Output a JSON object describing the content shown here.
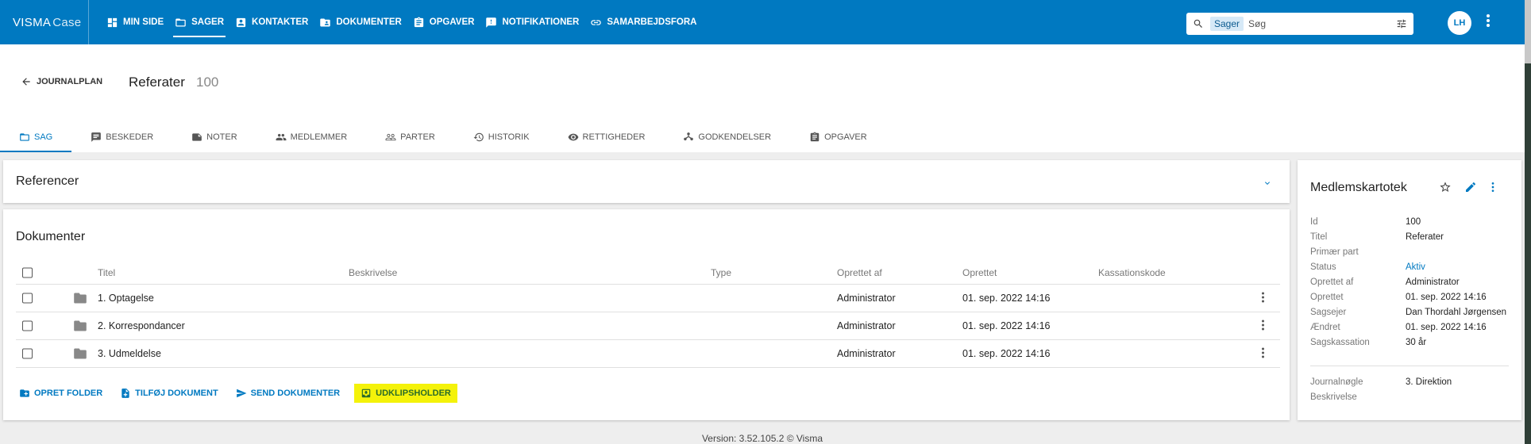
{
  "app": {
    "logo_main": "VISMA",
    "logo_sub": "Case"
  },
  "nav": [
    {
      "label": "MIN SIDE",
      "icon": "dashboard-icon",
      "active": false
    },
    {
      "label": "SAGER",
      "icon": "folder-icon",
      "active": true
    },
    {
      "label": "KONTAKTER",
      "icon": "contact-icon",
      "active": false
    },
    {
      "label": "DOKUMENTER",
      "icon": "folder-shared-icon",
      "active": false
    },
    {
      "label": "OPGAVER",
      "icon": "clipboard-icon",
      "active": false
    },
    {
      "label": "NOTIFIKATIONER",
      "icon": "feedback-icon",
      "active": false
    },
    {
      "label": "SAMARBEJDSFORA",
      "icon": "link-icon",
      "active": false
    }
  ],
  "search": {
    "scope": "Sager",
    "placeholder": "Søg"
  },
  "user": {
    "initials": "LH"
  },
  "header": {
    "back_label": "JOURNALPLAN",
    "title": "Referater",
    "number": "100"
  },
  "tabs": [
    {
      "label": "SAG",
      "active": true
    },
    {
      "label": "BESKEDER",
      "active": false
    },
    {
      "label": "NOTER",
      "active": false
    },
    {
      "label": "MEDLEMMER",
      "active": false
    },
    {
      "label": "PARTER",
      "active": false
    },
    {
      "label": "HISTORIK",
      "active": false
    },
    {
      "label": "RETTIGHEDER",
      "active": false
    },
    {
      "label": "GODKENDELSER",
      "active": false
    },
    {
      "label": "OPGAVER",
      "active": false
    }
  ],
  "references": {
    "title": "Referencer"
  },
  "documents": {
    "title": "Dokumenter",
    "columns": {
      "title": "Titel",
      "description": "Beskrivelse",
      "type": "Type",
      "created_by": "Oprettet af",
      "created": "Oprettet",
      "disposal": "Kassationskode"
    },
    "rows": [
      {
        "title": "1. Optagelse",
        "description": "",
        "type": "",
        "created_by": "Administrator",
        "created": "01. sep. 2022 14:16",
        "disposal": ""
      },
      {
        "title": "2. Korrespondancer",
        "description": "",
        "type": "",
        "created_by": "Administrator",
        "created": "01. sep. 2022 14:16",
        "disposal": ""
      },
      {
        "title": "3. Udmeldelse",
        "description": "",
        "type": "",
        "created_by": "Administrator",
        "created": "01. sep. 2022 14:16",
        "disposal": ""
      }
    ],
    "actions": {
      "create_folder": "OPRET FOLDER",
      "add_document": "TILFØJ DOKUMENT",
      "send_documents": "SEND DOKUMENTER",
      "clipboard": "UDKLIPSHOLDER"
    },
    "highlight_color": "#f4f20a"
  },
  "member_file": {
    "title": "Medlemskartotek",
    "props": [
      {
        "key": "Id",
        "value": "100"
      },
      {
        "key": "Titel",
        "value": "Referater"
      },
      {
        "key": "Primær part",
        "value": ""
      },
      {
        "key": "Status",
        "value": "Aktiv"
      },
      {
        "key": "Oprettet af",
        "value": "Administrator"
      },
      {
        "key": "Oprettet",
        "value": "01. sep. 2022 14:16"
      },
      {
        "key": "Sagsejer",
        "value": "Dan Thordahl Jørgensen"
      },
      {
        "key": "Ændret",
        "value": "01. sep. 2022 14:16"
      },
      {
        "key": "Sagskassation",
        "value": "30 år"
      }
    ],
    "props2": [
      {
        "key": "Journalnøgle",
        "value": "3. Direktion"
      },
      {
        "key": "Beskrivelse",
        "value": ""
      }
    ]
  },
  "footer": {
    "text": "Version: 3.52.105.2   © Visma"
  },
  "colors": {
    "primary": "#0079c1",
    "background": "#eeeeee"
  }
}
